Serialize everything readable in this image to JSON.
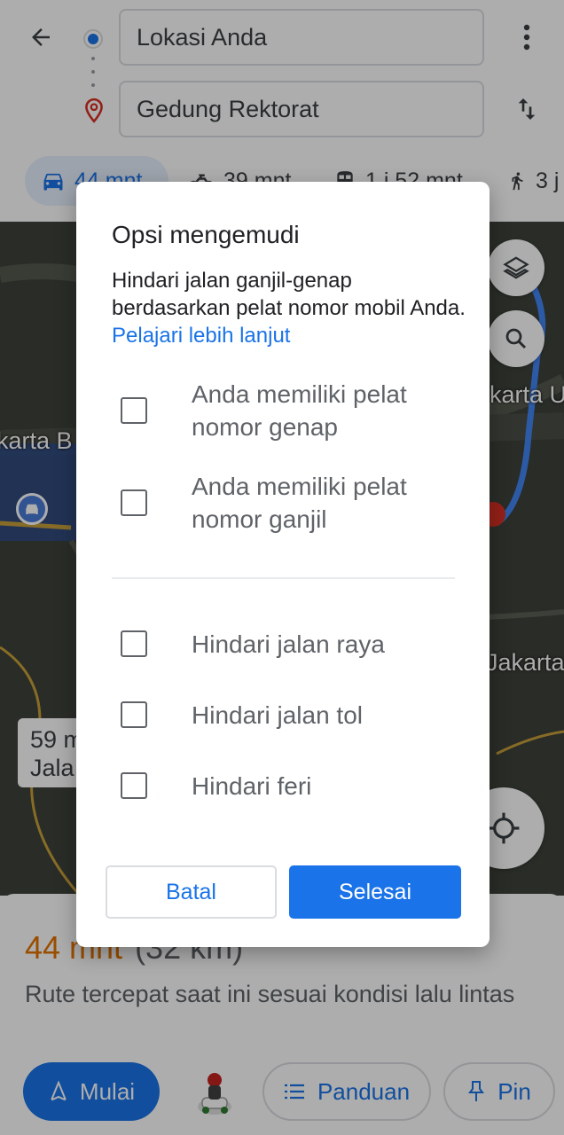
{
  "header": {
    "origin_value": "Lokasi Anda",
    "destination_value": "Gedung Rektorat",
    "modes": [
      {
        "icon": "car-icon",
        "label": "44 mnt"
      },
      {
        "icon": "motorcycle-icon",
        "label": "39 mnt"
      },
      {
        "icon": "transit-icon",
        "label": "1 j 52 mnt"
      },
      {
        "icon": "walk-icon",
        "label": "3 j"
      }
    ]
  },
  "map": {
    "labels": [
      "karta B",
      "karta U",
      "Jakarta"
    ],
    "route_bubble_lines": [
      "59 m",
      "Jala"
    ]
  },
  "sheet": {
    "eta": "44 mnt",
    "distance": "(32 km)",
    "description": "Rute tercepat saat ini sesuai kondisi lalu lintas",
    "start_label": "Mulai",
    "guide_label": "Panduan",
    "pin_label": "Pin"
  },
  "dialog": {
    "title": "Opsi mengemudi",
    "description": "Hindari jalan ganjil-genap berdasarkan pelat nomor mobil Anda.",
    "learn_more": "Pelajari lebih lanjut",
    "options": [
      {
        "label": "Anda memiliki pelat nomor genap",
        "checked": false
      },
      {
        "label": "Anda memiliki pelat nomor ganjil",
        "checked": false
      },
      {
        "label": "Hindari jalan raya",
        "checked": false
      },
      {
        "label": "Hindari jalan tol",
        "checked": false
      },
      {
        "label": "Hindari feri",
        "checked": false
      }
    ],
    "cancel_label": "Batal",
    "done_label": "Selesai"
  },
  "colors": {
    "accent": "#1a73e8",
    "eta": "#e37400",
    "scrim": "rgba(0,0,0,0.32)"
  }
}
